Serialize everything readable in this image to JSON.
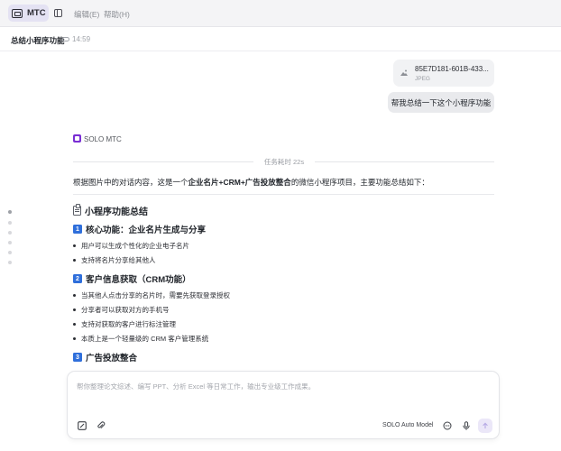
{
  "titlebar": {
    "app_label": "MTC",
    "menu": {
      "edit": "编辑(E)",
      "help": "帮助(H)"
    }
  },
  "header": {
    "title": "总结小程序功能",
    "time": "14:59"
  },
  "messages": {
    "attachment": {
      "name": "85E7D181-601B-433...",
      "type": "JPEG"
    },
    "user_text": "帮我总结一下这个小程序功能",
    "assistant": {
      "name": "SOLO MTC",
      "task_time": "任务耗时 22s",
      "intro": {
        "prefix": "根据图片中的对话内容，这是一个",
        "bold": "企业名片+CRM+广告投放整合",
        "suffix": "的微信小程序项目，主要功能总结如下："
      },
      "summary_title": "小程序功能总结",
      "sections": [
        {
          "number": "1",
          "title": "核心功能：企业名片生成与分享",
          "bullets": [
            "用户可以生成个性化的企业电子名片",
            "支持将名片分享给其他人"
          ]
        },
        {
          "number": "2",
          "title": "客户信息获取（CRM功能）",
          "bullets": [
            "当其他人点击分享的名片时，需要先获取登录授权",
            "分享者可以获取对方的手机号",
            "支持对获取的客户进行标注管理",
            "本质上是一个轻量级的 CRM 客户管理系统"
          ]
        },
        {
          "number": "3",
          "title": "广告投放整合",
          "bullets": []
        }
      ]
    }
  },
  "composer": {
    "placeholder": "帮你整理论文综述、编写 PPT、分析 Excel 等日常工作，输出专业级工作成果。",
    "model": "SOLO Auto Model"
  },
  "colors": {
    "accent": "#7a2fd4",
    "badge": "#2f6fdb",
    "app_button_bg": "#e4e2f3"
  }
}
